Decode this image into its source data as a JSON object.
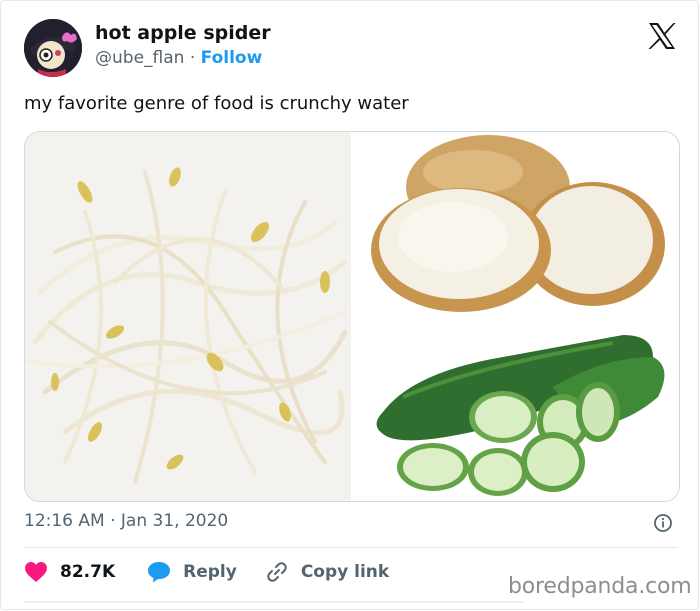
{
  "author": {
    "display_name": "hot apple spider",
    "handle": "@ube_flan",
    "separator": " · ",
    "follow_label": "Follow"
  },
  "tweet": {
    "text": "my favorite genre of food is crunchy water",
    "time": "12:16 AM",
    "date_separator": " · ",
    "date": "Jan 31, 2020"
  },
  "media": {
    "images": [
      "bean-sprouts-photo",
      "jicama-photo",
      "cucumber-photo"
    ]
  },
  "actions": {
    "likes": "82.7K",
    "reply_label": "Reply",
    "copy_link_label": "Copy link"
  },
  "colors": {
    "like": "#f91880",
    "reply": "#1d9bf0",
    "link": "#1d9bf0",
    "secondary_text": "#536471"
  },
  "watermark": "boredpanda.com"
}
